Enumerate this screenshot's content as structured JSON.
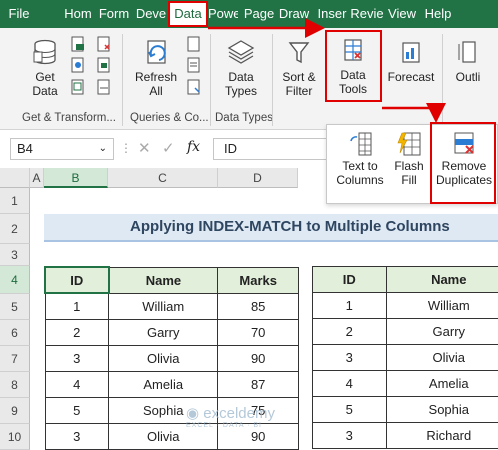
{
  "menu": {
    "tabs": [
      "File",
      "Hom",
      "Form",
      "Deve",
      "Data",
      "Powe",
      "Page",
      "Draw",
      "Inser",
      "Revie",
      "View",
      "Help"
    ],
    "active": "Data"
  },
  "ribbon": {
    "get_data": "Get Data",
    "refresh_all": "Refresh All",
    "data_types": "Data Types",
    "sort_filter": "Sort & Filter",
    "data_tools": "Data Tools",
    "forecast": "Forecast",
    "outline": "Outli",
    "groups": {
      "get_transform": "Get & Transform...",
      "queries": "Queries & Co...",
      "data_types": "Data Types"
    }
  },
  "popup": {
    "text_to_columns": "Text to Columns",
    "flash_fill": "Flash Fill",
    "remove_duplicates": "Remove Duplicates"
  },
  "formula_bar": {
    "name_box": "B4",
    "fx": "fx",
    "value": "ID"
  },
  "grid": {
    "columns": [
      "A",
      "B",
      "C",
      "D"
    ],
    "rows": [
      "1",
      "2",
      "3",
      "4",
      "5",
      "6",
      "7",
      "8",
      "9",
      "10"
    ],
    "selected_column": "B",
    "selected_row": "4"
  },
  "sheet": {
    "title": "Applying INDEX-MATCH to Multiple Columns",
    "table1": {
      "headers": [
        "ID",
        "Name",
        "Marks"
      ],
      "rows": [
        [
          "1",
          "William",
          "85"
        ],
        [
          "2",
          "Garry",
          "70"
        ],
        [
          "3",
          "Olivia",
          "90"
        ],
        [
          "4",
          "Amelia",
          "87"
        ],
        [
          "5",
          "Sophia",
          "75"
        ],
        [
          "3",
          "Olivia",
          "90"
        ]
      ]
    },
    "table2": {
      "headers": [
        "ID",
        "Name"
      ],
      "rows": [
        [
          "1",
          "William"
        ],
        [
          "2",
          "Garry"
        ],
        [
          "3",
          "Olivia"
        ],
        [
          "4",
          "Amelia"
        ],
        [
          "5",
          "Sophia"
        ],
        [
          "3",
          "Richard"
        ]
      ]
    }
  },
  "watermark": {
    "brand": "exceldemy",
    "tagline": "EXCEL · DATA · BI"
  },
  "colors": {
    "excel_green": "#217346",
    "highlight_red": "#e00000",
    "header_fill": "#e2efda",
    "title_fill": "#dfe9f4"
  }
}
